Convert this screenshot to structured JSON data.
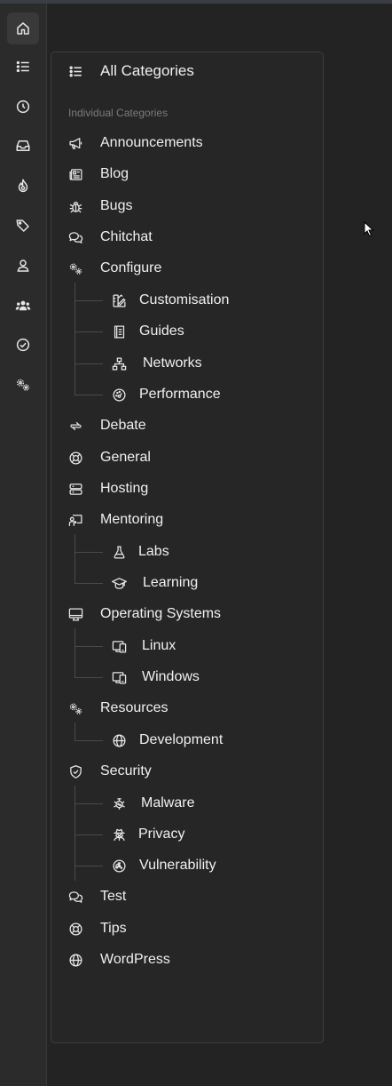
{
  "all_categories": {
    "label": "All Categories",
    "icon": "list-icon"
  },
  "section_label": "Individual Categories",
  "rail": [
    {
      "name": "home",
      "icon": "home-icon"
    },
    {
      "name": "list",
      "icon": "list-icon"
    },
    {
      "name": "recent",
      "icon": "clock-icon"
    },
    {
      "name": "inbox",
      "icon": "inbox-icon"
    },
    {
      "name": "hot",
      "icon": "flame-icon"
    },
    {
      "name": "tags",
      "icon": "tag-icon"
    },
    {
      "name": "user",
      "icon": "user-icon"
    },
    {
      "name": "groups",
      "icon": "users-icon"
    },
    {
      "name": "solved",
      "icon": "check-circle-icon"
    },
    {
      "name": "settings",
      "icon": "gears-icon"
    }
  ],
  "categories": [
    {
      "label": "Announcements",
      "icon": "megaphone-icon"
    },
    {
      "label": "Blog",
      "icon": "newspaper-icon"
    },
    {
      "label": "Bugs",
      "icon": "bug-icon"
    },
    {
      "label": "Chitchat",
      "icon": "chat-icon"
    },
    {
      "label": "Configure",
      "icon": "gears-icon"
    },
    {
      "label": "Customisation",
      "icon": "design-icon"
    },
    {
      "label": "Guides",
      "icon": "book-icon"
    },
    {
      "label": "Networks",
      "icon": "network-icon"
    },
    {
      "label": "Performance",
      "icon": "gauge-icon"
    },
    {
      "label": "Debate",
      "icon": "exchange-icon"
    },
    {
      "label": "General",
      "icon": "lifebuoy-icon"
    },
    {
      "label": "Hosting",
      "icon": "server-icon"
    },
    {
      "label": "Mentoring",
      "icon": "chalkboard-icon"
    },
    {
      "label": "Labs",
      "icon": "flask-icon"
    },
    {
      "label": "Learning",
      "icon": "graduation-cap-icon"
    },
    {
      "label": "Operating Systems",
      "icon": "desktop-icon"
    },
    {
      "label": "Linux",
      "icon": "devices-icon"
    },
    {
      "label": "Windows",
      "icon": "devices-icon"
    },
    {
      "label": "Resources",
      "icon": "gears-icon"
    },
    {
      "label": "Development",
      "icon": "globe-icon"
    },
    {
      "label": "Security",
      "icon": "shield-icon"
    },
    {
      "label": "Malware",
      "icon": "virus-icon"
    },
    {
      "label": "Privacy",
      "icon": "spy-icon"
    },
    {
      "label": "Vulnerability",
      "icon": "radiation-icon"
    },
    {
      "label": "Test",
      "icon": "chat-icon"
    },
    {
      "label": "Tips",
      "icon": "lifebuoy-icon"
    },
    {
      "label": "WordPress",
      "icon": "globe-icon"
    }
  ]
}
